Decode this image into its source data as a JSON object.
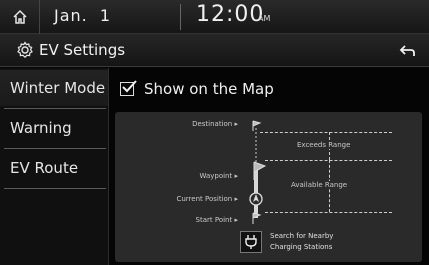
{
  "status_bar": {
    "date": "Jan.  1",
    "time": "12:00",
    "ampm": "AM",
    "icons": {
      "home": "home-icon"
    }
  },
  "title_bar": {
    "title": "EV Settings",
    "icons": {
      "settings": "gear-icon",
      "back": "back-arrow-icon"
    }
  },
  "sidebar": {
    "items": [
      {
        "label": "Winter Mode",
        "active": true
      },
      {
        "label": "Warning",
        "active": false
      },
      {
        "label": "EV Route",
        "active": false
      }
    ]
  },
  "main": {
    "show_on_map": {
      "label": "Show on the Map",
      "checked": true
    },
    "diagram": {
      "labels": {
        "destination": "Destination",
        "waypoint": "Waypoint",
        "current_position": "Current Position",
        "start_point": "Start Point",
        "exceeds_range": "Exceeds Range",
        "available_range": "Available Range"
      },
      "charger": {
        "line1": "Search for Nearby",
        "line2": "Charging Stations",
        "icon": "charger-plug-icon"
      }
    }
  },
  "colors": {
    "background": "#050505",
    "panel": "#2a2a2a",
    "text": "#e6e6e6"
  }
}
